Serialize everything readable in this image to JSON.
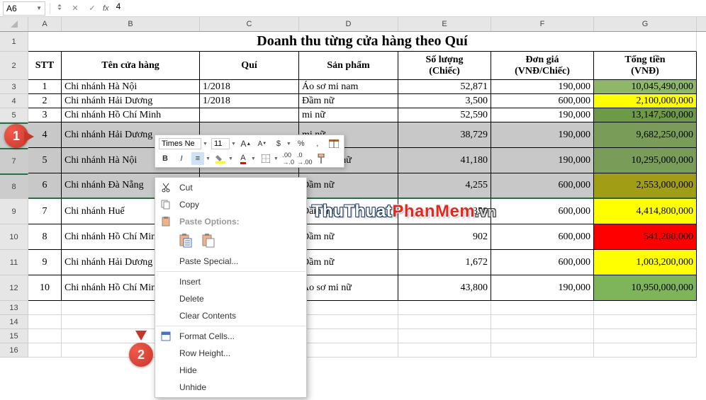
{
  "namebox": {
    "ref": "A6",
    "fx": "fx",
    "formula": "4"
  },
  "col_headers": [
    "A",
    "B",
    "C",
    "D",
    "E",
    "F",
    "G"
  ],
  "title": "Doanh thu từng cửa hàng theo Quí",
  "headers": {
    "stt": "STT",
    "ten": "Tên cửa hàng",
    "qui": "Quí",
    "sp": "Sản phẩm",
    "sl1": "Số lượng",
    "sl2": "(Chiếc)",
    "dg1": "Đơn giá",
    "dg2": "(VNĐ/Chiếc)",
    "tt1": "Tổng tiền",
    "tt2": "(VNĐ)"
  },
  "rows": [
    {
      "r": 3,
      "stt": "1",
      "ten": "Chi nhánh Hà Nội",
      "qui": "1/2018",
      "sp": "Áo sơ mi nam",
      "sl": "52,871",
      "dg": "190,000",
      "tt": "10,045,490,000",
      "cls": "bg-green1"
    },
    {
      "r": 4,
      "stt": "2",
      "ten": "Chi nhánh Hải Dương",
      "qui": "1/2018",
      "sp": "Đầm nữ",
      "sl": "3,500",
      "dg": "600,000",
      "tt": "2,100,000,000",
      "cls": "bg-yellow"
    },
    {
      "r": 5,
      "stt": "3",
      "ten": "Chi nhánh Hồ Chí Minh",
      "qui": "",
      "sp": "mi nữ",
      "sl": "52,590",
      "dg": "190,000",
      "tt": "13,147,500,000",
      "cls": "bg-green2"
    },
    {
      "r": 6,
      "stt": "4",
      "ten": "Chi nhánh Hải Dương",
      "qui": "",
      "sp": "mi nữ",
      "sl": "38,729",
      "dg": "190,000",
      "tt": "9,682,250,000",
      "cls": "bg-green1"
    },
    {
      "r": 7,
      "stt": "5",
      "ten": "Chi nhánh Hà Nội",
      "qui": "",
      "sp": "Áo sơ mi nữ",
      "sl": "41,180",
      "dg": "190,000",
      "tt": "10,295,000,000",
      "cls": "bg-green1"
    },
    {
      "r": 8,
      "stt": "6",
      "ten": "Chi nhánh Đà Nẵng",
      "qui": "",
      "sp": "Đầm nữ",
      "sl": "4,255",
      "dg": "600,000",
      "tt": "2,553,000,000",
      "cls": "bg-olive"
    },
    {
      "r": 9,
      "stt": "7",
      "ten": "Chi nhánh Huế",
      "qui": "",
      "sp": "Đầm nữ",
      "sl": "7,358",
      "dg": "600,000",
      "tt": "4,414,800,000",
      "cls": "bg-yellow"
    },
    {
      "r": 10,
      "stt": "8",
      "ten": "Chi nhánh Hồ Chí Minh",
      "qui": "",
      "sp": "Đầm nữ",
      "sl": "902",
      "dg": "600,000",
      "tt": "541,200,000",
      "cls": "bg-red"
    },
    {
      "r": 11,
      "stt": "9",
      "ten": "Chi nhánh Hải Dương",
      "qui": "",
      "sp": "Đầm nữ",
      "sl": "1,672",
      "dg": "600,000",
      "tt": "1,003,200,000",
      "cls": "bg-yellow"
    },
    {
      "r": 12,
      "stt": "10",
      "ten": "Chi nhánh Hồ Chí Minh",
      "qui": "",
      "sp": "Áo sơ mi nữ",
      "sl": "43,800",
      "dg": "190,000",
      "tt": "10,950,000,000",
      "cls": "bg-green4"
    }
  ],
  "empty_rows": [
    13,
    14,
    15,
    16
  ],
  "mini": {
    "font": "Times Ne",
    "size": "11"
  },
  "ctx": {
    "cut": "Cut",
    "copy": "Copy",
    "paste_opts": "Paste Options:",
    "paste_special": "Paste Special...",
    "insert": "Insert",
    "delete": "Delete",
    "clear": "Clear Contents",
    "format": "Format Cells...",
    "rowh": "Row Height...",
    "hide": "Hide",
    "unhide": "Unhide"
  },
  "callouts": {
    "c1": "1",
    "c2": "2"
  },
  "watermark": {
    "a": "ThuThuat",
    "b": "PhanMem",
    "c": ".vn"
  }
}
